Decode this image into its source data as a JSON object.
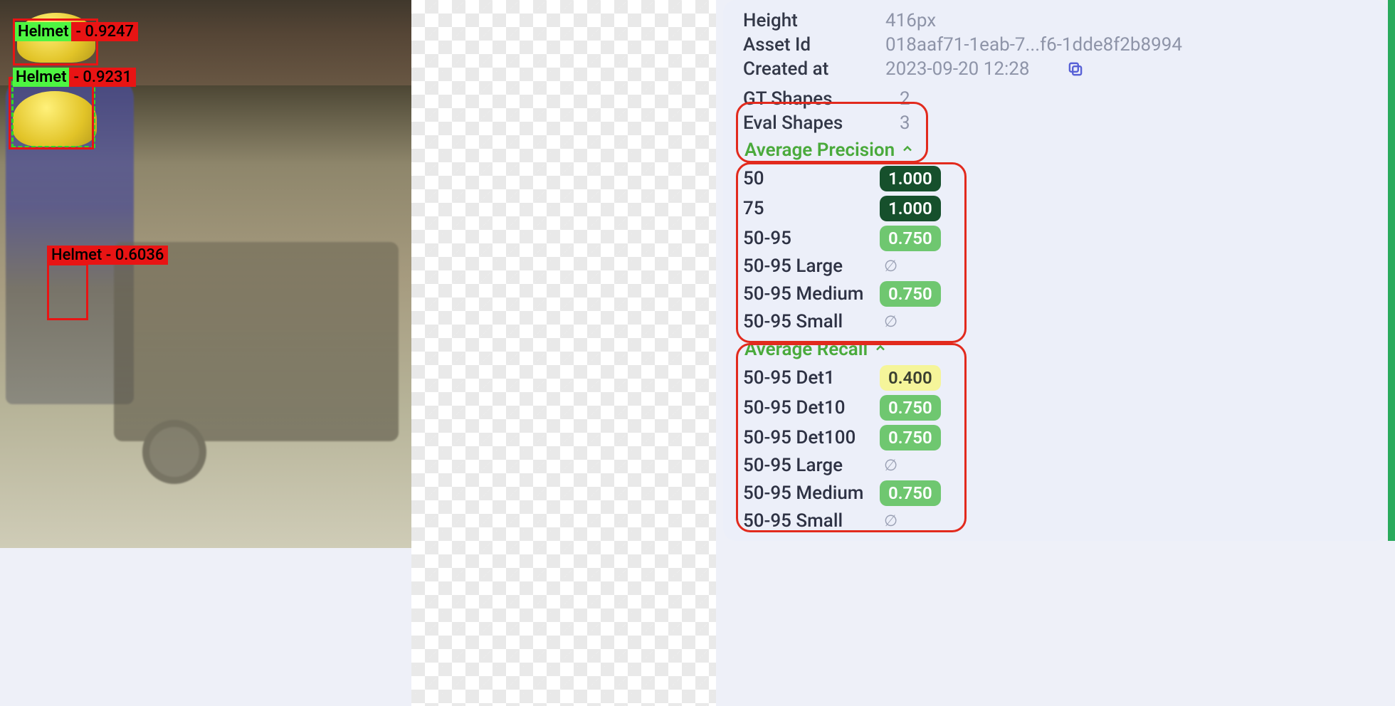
{
  "detections": [
    {
      "label": "Helmet",
      "score": "0.9247"
    },
    {
      "label": "Helmet",
      "score": "0.9231"
    },
    {
      "label": "Helmet",
      "score": "0.6036"
    }
  ],
  "meta": {
    "height_label": "Height",
    "height_value": "416px",
    "asset_id_label": "Asset Id",
    "asset_id_value": "018aaf71-1eab-7...f6-1dde8f2b8994",
    "created_label": "Created at",
    "created_value": "2023-09-20 12:28",
    "gt_shapes_label": "GT Shapes",
    "gt_shapes_value": "2",
    "eval_shapes_label": "Eval Shapes",
    "eval_shapes_value": "3"
  },
  "ap": {
    "title": "Average Precision",
    "rows": [
      {
        "k": "50",
        "v": "1.000",
        "style": "dark"
      },
      {
        "k": "75",
        "v": "1.000",
        "style": "dark"
      },
      {
        "k": "50-95",
        "v": "0.750",
        "style": "green"
      },
      {
        "k": "50-95 Large",
        "v": "∅",
        "style": "empty"
      },
      {
        "k": "50-95 Medium",
        "v": "0.750",
        "style": "green"
      },
      {
        "k": "50-95 Small",
        "v": "∅",
        "style": "empty"
      }
    ]
  },
  "ar": {
    "title": "Average Recall",
    "rows": [
      {
        "k": "50-95 Det1",
        "v": "0.400",
        "style": "yellow"
      },
      {
        "k": "50-95 Det10",
        "v": "0.750",
        "style": "green"
      },
      {
        "k": "50-95 Det100",
        "v": "0.750",
        "style": "green"
      },
      {
        "k": "50-95 Large",
        "v": "∅",
        "style": "empty"
      },
      {
        "k": "50-95 Medium",
        "v": "0.750",
        "style": "green"
      },
      {
        "k": "50-95 Small",
        "v": "∅",
        "style": "empty"
      }
    ]
  }
}
